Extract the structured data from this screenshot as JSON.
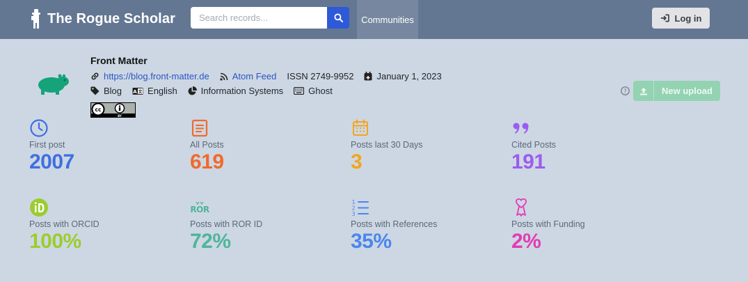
{
  "header": {
    "title": "The Rogue Scholar",
    "search_placeholder": "Search records...",
    "nav_communities": "Communities",
    "login_label": "Log in"
  },
  "community": {
    "name": "Front Matter",
    "url": "https://blog.front-matter.de",
    "feed_label": "Atom Feed",
    "issn": "ISSN 2749-9952",
    "date": "January 1, 2023",
    "category": "Blog",
    "language": "English",
    "subject": "Information Systems",
    "platform": "Ghost",
    "upload_label": "New upload"
  },
  "stats": [
    {
      "label": "First post",
      "value": "2007",
      "color": "#3f6fe0",
      "icon": "clock-icon"
    },
    {
      "label": "All Posts",
      "value": "619",
      "color": "#f06a2d",
      "icon": "document-icon"
    },
    {
      "label": "Posts last 30 Days",
      "value": "3",
      "color": "#f2a51c",
      "icon": "calendar-icon"
    },
    {
      "label": "Cited Posts",
      "value": "191",
      "color": "#9b5cf0",
      "icon": "quote-icon"
    },
    {
      "label": "Posts with ORCID",
      "value": "100%",
      "color": "#9ccc2e",
      "icon": "orcid-icon"
    },
    {
      "label": "Posts with ROR ID",
      "value": "72%",
      "color": "#4fb59a",
      "icon": "ror-icon"
    },
    {
      "label": "Posts with References",
      "value": "35%",
      "color": "#4a86ee",
      "icon": "list-ordered-icon"
    },
    {
      "label": "Posts with Funding",
      "value": "2%",
      "color": "#e23cb4",
      "icon": "award-icon"
    }
  ]
}
